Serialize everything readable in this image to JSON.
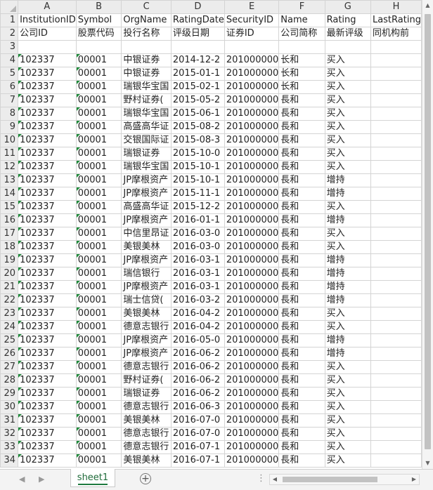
{
  "columns": [
    "A",
    "B",
    "C",
    "D",
    "E",
    "F",
    "G",
    "H"
  ],
  "rows": [
    {
      "n": "1",
      "cells": [
        "InstitutionID",
        "Symbol",
        "OrgName",
        "RatingDate",
        "SecurityID",
        "Name",
        "Rating",
        "LastRating"
      ]
    },
    {
      "n": "2",
      "cells": [
        "公司ID",
        "股票代码",
        "投行名称",
        "评级日期",
        "证券ID",
        "公司简称",
        "最新评级",
        "同机构前"
      ]
    },
    {
      "n": "3",
      "cells": [
        "",
        "",
        "",
        "",
        "",
        "",
        "",
        ""
      ]
    },
    {
      "n": "4",
      "cells": [
        "102337",
        "00001",
        "中银证券",
        "2014-12-2",
        "201000000",
        "长和",
        "买入",
        ""
      ]
    },
    {
      "n": "5",
      "cells": [
        "102337",
        "00001",
        "中银证券",
        "2015-01-1",
        "201000000",
        "长和",
        "买入",
        ""
      ]
    },
    {
      "n": "6",
      "cells": [
        "102337",
        "00001",
        "瑞银华宝国",
        "2015-02-1",
        "201000000",
        "长和",
        "买入",
        ""
      ]
    },
    {
      "n": "7",
      "cells": [
        "102337",
        "00001",
        "野村证券(",
        "2015-05-2",
        "201000000",
        "長和",
        "买入",
        ""
      ]
    },
    {
      "n": "8",
      "cells": [
        "102337",
        "00001",
        "瑞银华宝国",
        "2015-06-1",
        "201000000",
        "長和",
        "买入",
        ""
      ]
    },
    {
      "n": "9",
      "cells": [
        "102337",
        "00001",
        "高盛高华证",
        "2015-08-2",
        "201000000",
        "長和",
        "买入",
        ""
      ]
    },
    {
      "n": "10",
      "cells": [
        "102337",
        "00001",
        "交银国际证",
        "2015-08-3",
        "201000000",
        "長和",
        "买入",
        ""
      ]
    },
    {
      "n": "11",
      "cells": [
        "102337",
        "00001",
        "瑞银证券",
        "2015-10-0",
        "201000000",
        "長和",
        "买入",
        ""
      ]
    },
    {
      "n": "12",
      "cells": [
        "102337",
        "00001",
        "瑞银华宝国",
        "2015-10-1",
        "201000000",
        "長和",
        "买入",
        ""
      ]
    },
    {
      "n": "13",
      "cells": [
        "102337",
        "00001",
        "JP摩根资产",
        "2015-10-1",
        "201000000",
        "長和",
        "增持",
        ""
      ]
    },
    {
      "n": "14",
      "cells": [
        "102337",
        "00001",
        "JP摩根资产",
        "2015-11-1",
        "201000000",
        "長和",
        "增持",
        ""
      ]
    },
    {
      "n": "15",
      "cells": [
        "102337",
        "00001",
        "高盛高华证",
        "2015-12-2",
        "201000000",
        "長和",
        "买入",
        ""
      ]
    },
    {
      "n": "16",
      "cells": [
        "102337",
        "00001",
        "JP摩根资产",
        "2016-01-1",
        "201000000",
        "長和",
        "增持",
        ""
      ]
    },
    {
      "n": "17",
      "cells": [
        "102337",
        "00001",
        "中信里昂证",
        "2016-03-0",
        "201000000",
        "長和",
        "买入",
        ""
      ]
    },
    {
      "n": "18",
      "cells": [
        "102337",
        "00001",
        "美银美林",
        "2016-03-0",
        "201000000",
        "長和",
        "买入",
        ""
      ]
    },
    {
      "n": "19",
      "cells": [
        "102337",
        "00001",
        "JP摩根资产",
        "2016-03-1",
        "201000000",
        "長和",
        "增持",
        ""
      ]
    },
    {
      "n": "20",
      "cells": [
        "102337",
        "00001",
        "瑞信银行",
        "2016-03-1",
        "201000000",
        "長和",
        "增持",
        ""
      ]
    },
    {
      "n": "21",
      "cells": [
        "102337",
        "00001",
        "JP摩根资产",
        "2016-03-1",
        "201000000",
        "長和",
        "增持",
        ""
      ]
    },
    {
      "n": "22",
      "cells": [
        "102337",
        "00001",
        "瑞士信贷(",
        "2016-03-2",
        "201000000",
        "長和",
        "增持",
        ""
      ]
    },
    {
      "n": "23",
      "cells": [
        "102337",
        "00001",
        "美银美林",
        "2016-04-2",
        "201000000",
        "長和",
        "买入",
        ""
      ]
    },
    {
      "n": "24",
      "cells": [
        "102337",
        "00001",
        "德意志银行",
        "2016-04-2",
        "201000000",
        "長和",
        "买入",
        ""
      ]
    },
    {
      "n": "25",
      "cells": [
        "102337",
        "00001",
        "JP摩根资产",
        "2016-05-0",
        "201000000",
        "長和",
        "增持",
        ""
      ]
    },
    {
      "n": "26",
      "cells": [
        "102337",
        "00001",
        "JP摩根资产",
        "2016-06-2",
        "201000000",
        "長和",
        "增持",
        ""
      ]
    },
    {
      "n": "27",
      "cells": [
        "102337",
        "00001",
        "德意志银行",
        "2016-06-2",
        "201000000",
        "長和",
        "买入",
        ""
      ]
    },
    {
      "n": "28",
      "cells": [
        "102337",
        "00001",
        "野村证券(",
        "2016-06-2",
        "201000000",
        "長和",
        "买入",
        ""
      ]
    },
    {
      "n": "29",
      "cells": [
        "102337",
        "00001",
        "瑞银证券",
        "2016-06-2",
        "201000000",
        "長和",
        "买入",
        ""
      ]
    },
    {
      "n": "30",
      "cells": [
        "102337",
        "00001",
        "德意志银行",
        "2016-06-3",
        "201000000",
        "長和",
        "买入",
        ""
      ]
    },
    {
      "n": "31",
      "cells": [
        "102337",
        "00001",
        "美银美林",
        "2016-07-0",
        "201000000",
        "長和",
        "买入",
        ""
      ]
    },
    {
      "n": "32",
      "cells": [
        "102337",
        "00001",
        "德意志银行",
        "2016-07-0",
        "201000000",
        "長和",
        "买入",
        ""
      ]
    },
    {
      "n": "33",
      "cells": [
        "102337",
        "00001",
        "德意志银行",
        "2016-07-1",
        "201000000",
        "長和",
        "买入",
        ""
      ]
    },
    {
      "n": "34",
      "cells": [
        "102337",
        "00001",
        "美银美林",
        "2016-07-1",
        "201000000",
        "長和",
        "买入",
        ""
      ]
    }
  ],
  "sheet_tab": "sheet1",
  "add_sheet_icon": "plus-circle-icon",
  "colors": {
    "header_bg": "#ececec",
    "grid_line": "#d4d4d4",
    "tab_accent": "#1f7a3f",
    "number_flag": "#1e8a3a"
  }
}
